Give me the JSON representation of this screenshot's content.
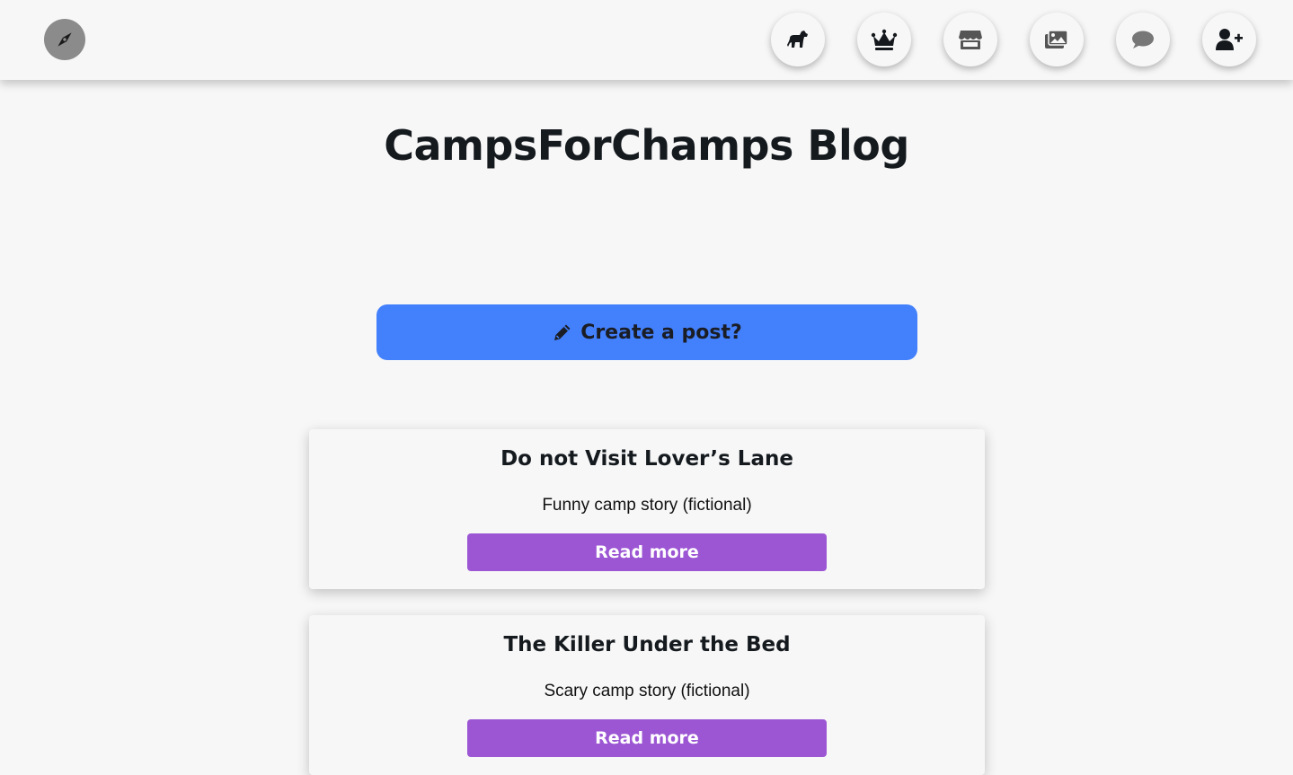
{
  "header": {
    "logo_icon": "compass-icon",
    "nav_icons": [
      "horse-icon",
      "crown-icon",
      "store-icon",
      "images-icon",
      "comment-icon",
      "user-plus-icon"
    ]
  },
  "main": {
    "title": "CampsForChamps Blog",
    "create_post": {
      "label": "Create a post?",
      "icon": "pencil-icon",
      "color": "#4380fc"
    }
  },
  "posts": [
    {
      "title": "Do not Visit Lover’s Lane",
      "description": "Funny camp story (fictional)",
      "button_label": "Read more"
    },
    {
      "title": "The Killer Under the Bed",
      "description": "Scary camp story (fictional)",
      "button_label": "Read more"
    }
  ],
  "colors": {
    "background": "#f7f7f7",
    "primary_button": "#4380fc",
    "read_more_button": "#9c56d4",
    "logo_circle": "#8b8b8b"
  }
}
